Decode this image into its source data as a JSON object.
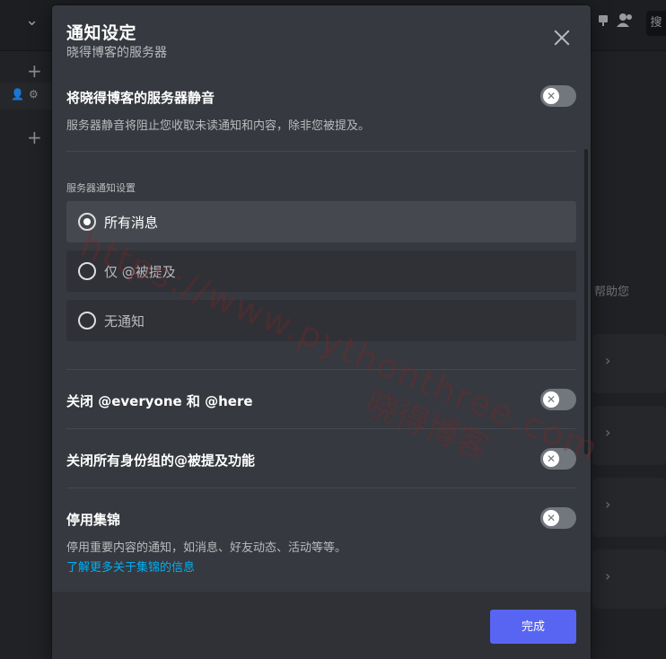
{
  "background": {
    "search_hint": "搜",
    "help_text": "帮助您"
  },
  "modal": {
    "title": "通知设定",
    "subtitle": "晓得博客的服务器"
  },
  "mute": {
    "title": "将晓得博客的服务器静音",
    "description": "服务器静音将阻止您收取未读通知和内容，除非您被提及。",
    "enabled": false
  },
  "server_notifications": {
    "section_label": "服务器通知设置",
    "options": [
      {
        "label": "所有消息",
        "selected": true
      },
      {
        "label": "仅 @被提及",
        "selected": false
      },
      {
        "label": "无通知",
        "selected": false
      }
    ]
  },
  "suppress_everyone": {
    "title": "关闭 @everyone 和 @here",
    "enabled": false
  },
  "suppress_roles": {
    "title": "关闭所有身份组的@被提及功能",
    "enabled": false
  },
  "highlights": {
    "title": "停用集锦",
    "description": "停用重要内容的通知，如消息、好友动态、活动等等。",
    "link": "了解更多关于集锦的信息",
    "enabled": false
  },
  "footer": {
    "done_label": "完成"
  },
  "watermark": {
    "line1": "https://www.pythonthree.com",
    "line2": "晓得博客"
  },
  "colors": {
    "accent": "#5865f2",
    "link": "#00aff4",
    "toggle_off": "#72767d"
  }
}
